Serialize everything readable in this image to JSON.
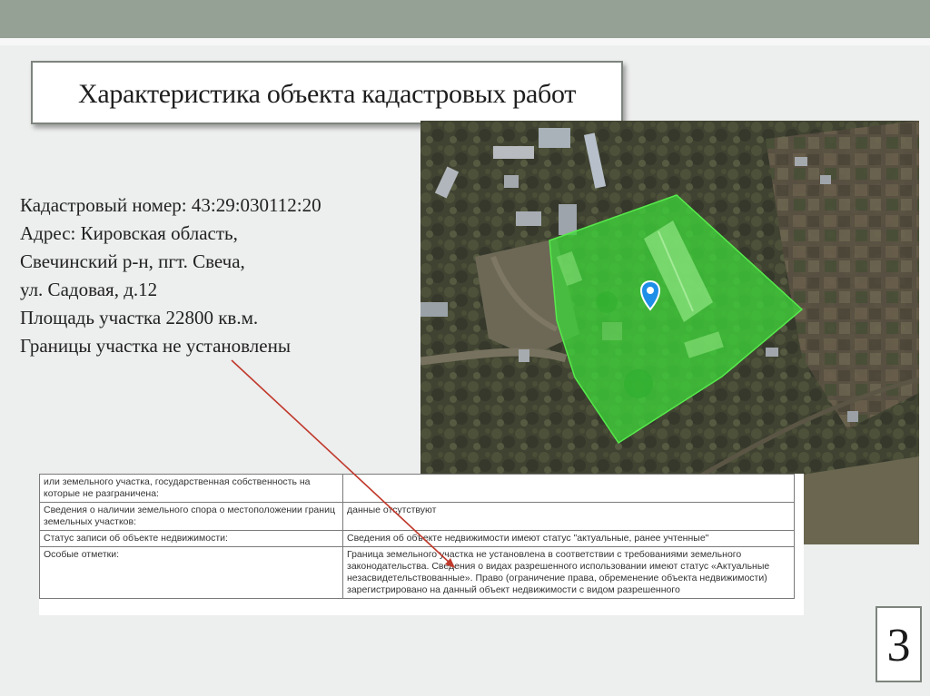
{
  "slide": {
    "title": "Характеристика объекта кадастровых работ",
    "page_number": "3"
  },
  "info": {
    "lines": [
      "Кадастровый номер: 43:29:030112:20",
      "Адрес: Кировская область,",
      "Свечинский р-н, пгт. Свеча,",
      "ул. Садовая, д.12",
      "Площадь участка 22800 кв.м.",
      "Границы участка не установлены"
    ]
  },
  "map": {
    "parcel_color": "#3dd43a",
    "marker_color": "#1e8ee8"
  },
  "doc_excerpt": {
    "rows": [
      {
        "label": "или земельного участка, государственная собственность на которые не разграничена:",
        "value": ""
      },
      {
        "label": "Сведения о наличии земельного спора о местоположении границ земельных участков:",
        "value": "данные отсутствуют"
      },
      {
        "label": "Статус записи об объекте недвижимости:",
        "value": "Сведения об объекте недвижимости имеют статус \"актуальные, ранее учтенные\""
      },
      {
        "label": "Особые отметки:",
        "value": "Граница земельного участка не установлена в соответствии с требованиями земельного законодательства. Сведения о видах разрешенного использовании имеют статус «Актуальные незасвидетельствованные». Право (ограничение права, обременение объекта недвижимости) зарегистрировано на данный объект недвижимости с видом разрешенного"
      }
    ]
  },
  "arrow_color": "#c0392b"
}
